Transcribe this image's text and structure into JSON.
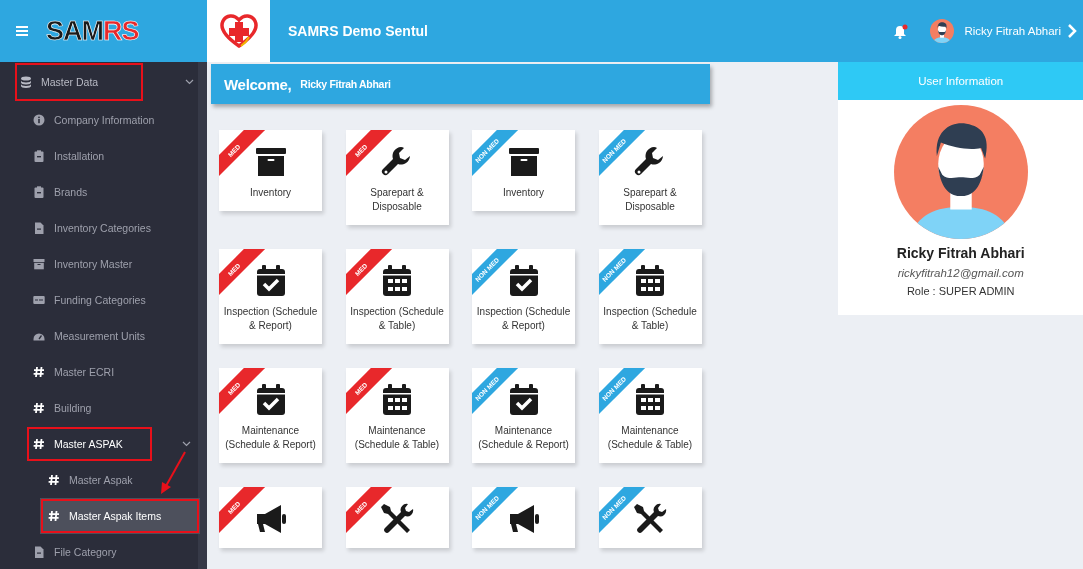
{
  "brand": {
    "logo_dark": "SAM",
    "logo_accent": "RS"
  },
  "header": {
    "title": "SAMRS Demo Sentul",
    "notification_unread": true,
    "user_name": "Ricky Fitrah Abhari"
  },
  "sidebar": {
    "arrow_to_selected": true,
    "items": [
      {
        "label": "Master Data",
        "kind": "database",
        "expanded": true,
        "selected": false,
        "annotated": true,
        "children": [
          {
            "label": "Company Information",
            "kind": "info",
            "selected": false,
            "annotated": false
          },
          {
            "label": "Installation",
            "kind": "clipboard",
            "selected": false,
            "annotated": false
          },
          {
            "label": "Brands",
            "kind": "clipboard",
            "selected": false,
            "annotated": false
          },
          {
            "label": "Inventory Categories",
            "kind": "file",
            "selected": false,
            "annotated": false
          },
          {
            "label": "Inventory Master",
            "kind": "archive",
            "selected": false,
            "annotated": false
          },
          {
            "label": "Funding Categories",
            "kind": "card",
            "selected": false,
            "annotated": false
          },
          {
            "label": "Measurement Units",
            "kind": "gauge",
            "selected": false,
            "annotated": false
          },
          {
            "label": "Master ECRI",
            "kind": "hash",
            "selected": false,
            "annotated": false
          },
          {
            "label": "Building",
            "kind": "hash",
            "selected": false,
            "annotated": false
          },
          {
            "label": "Master ASPAK",
            "kind": "hash",
            "expanded": true,
            "selected": false,
            "annotated": true,
            "children": [
              {
                "label": "Master Aspak",
                "kind": "hash",
                "selected": false,
                "annotated": false
              },
              {
                "label": "Master Aspak Items",
                "kind": "hash",
                "selected": true,
                "annotated": true
              }
            ]
          },
          {
            "label": "File Category",
            "kind": "file",
            "selected": false,
            "annotated": false
          }
        ]
      }
    ]
  },
  "welcome": {
    "greeting": "Welcome,",
    "name": "Ricky Fitrah Abhari"
  },
  "tiles": [
    {
      "ribbon": "MED",
      "color": "#e8282b",
      "kind": "archive",
      "label": "Inventory"
    },
    {
      "ribbon": "MED",
      "color": "#e8282b",
      "kind": "wrench",
      "label": "Sparepart & Disposable"
    },
    {
      "ribbon": "NON MED",
      "color": "#2ea7e0",
      "kind": "archive",
      "label": "Inventory"
    },
    {
      "ribbon": "NON MED",
      "color": "#2ea7e0",
      "kind": "wrench",
      "label": "Sparepart & Disposable"
    },
    {
      "ribbon": "MED",
      "color": "#e8282b",
      "kind": "calcheck",
      "label": "Inspection (Schedule & Report)"
    },
    {
      "ribbon": "MED",
      "color": "#e8282b",
      "kind": "calgrid",
      "label": "Inspection (Schedule & Table)"
    },
    {
      "ribbon": "NON MED",
      "color": "#2ea7e0",
      "kind": "calcheck",
      "label": "Inspection (Schedule & Report)"
    },
    {
      "ribbon": "NON MED",
      "color": "#2ea7e0",
      "kind": "calgrid",
      "label": "Inspection (Schedule & Table)"
    },
    {
      "ribbon": "MED",
      "color": "#e8282b",
      "kind": "calcheck",
      "label": "Maintenance (Schedule & Report)"
    },
    {
      "ribbon": "MED",
      "color": "#e8282b",
      "kind": "calgrid",
      "label": "Maintenance (Schedule & Table)"
    },
    {
      "ribbon": "NON MED",
      "color": "#2ea7e0",
      "kind": "calcheck",
      "label": "Maintenance (Schedule & Report)"
    },
    {
      "ribbon": "NON MED",
      "color": "#2ea7e0",
      "kind": "calgrid",
      "label": "Maintenance (Schedule & Table)"
    },
    {
      "ribbon": "MED",
      "color": "#e8282b",
      "kind": "megaphone"
    },
    {
      "ribbon": "MED",
      "color": "#e8282b",
      "kind": "tools"
    },
    {
      "ribbon": "NON MED",
      "color": "#2ea7e0",
      "kind": "megaphone"
    },
    {
      "ribbon": "NON MED",
      "color": "#2ea7e0",
      "kind": "tools"
    }
  ],
  "user_info": {
    "title": "User Information",
    "name": "Ricky Fitrah Abhari",
    "email": "rickyfitrah12@gmail.com",
    "role": "Role : SUPER ADMIN"
  }
}
